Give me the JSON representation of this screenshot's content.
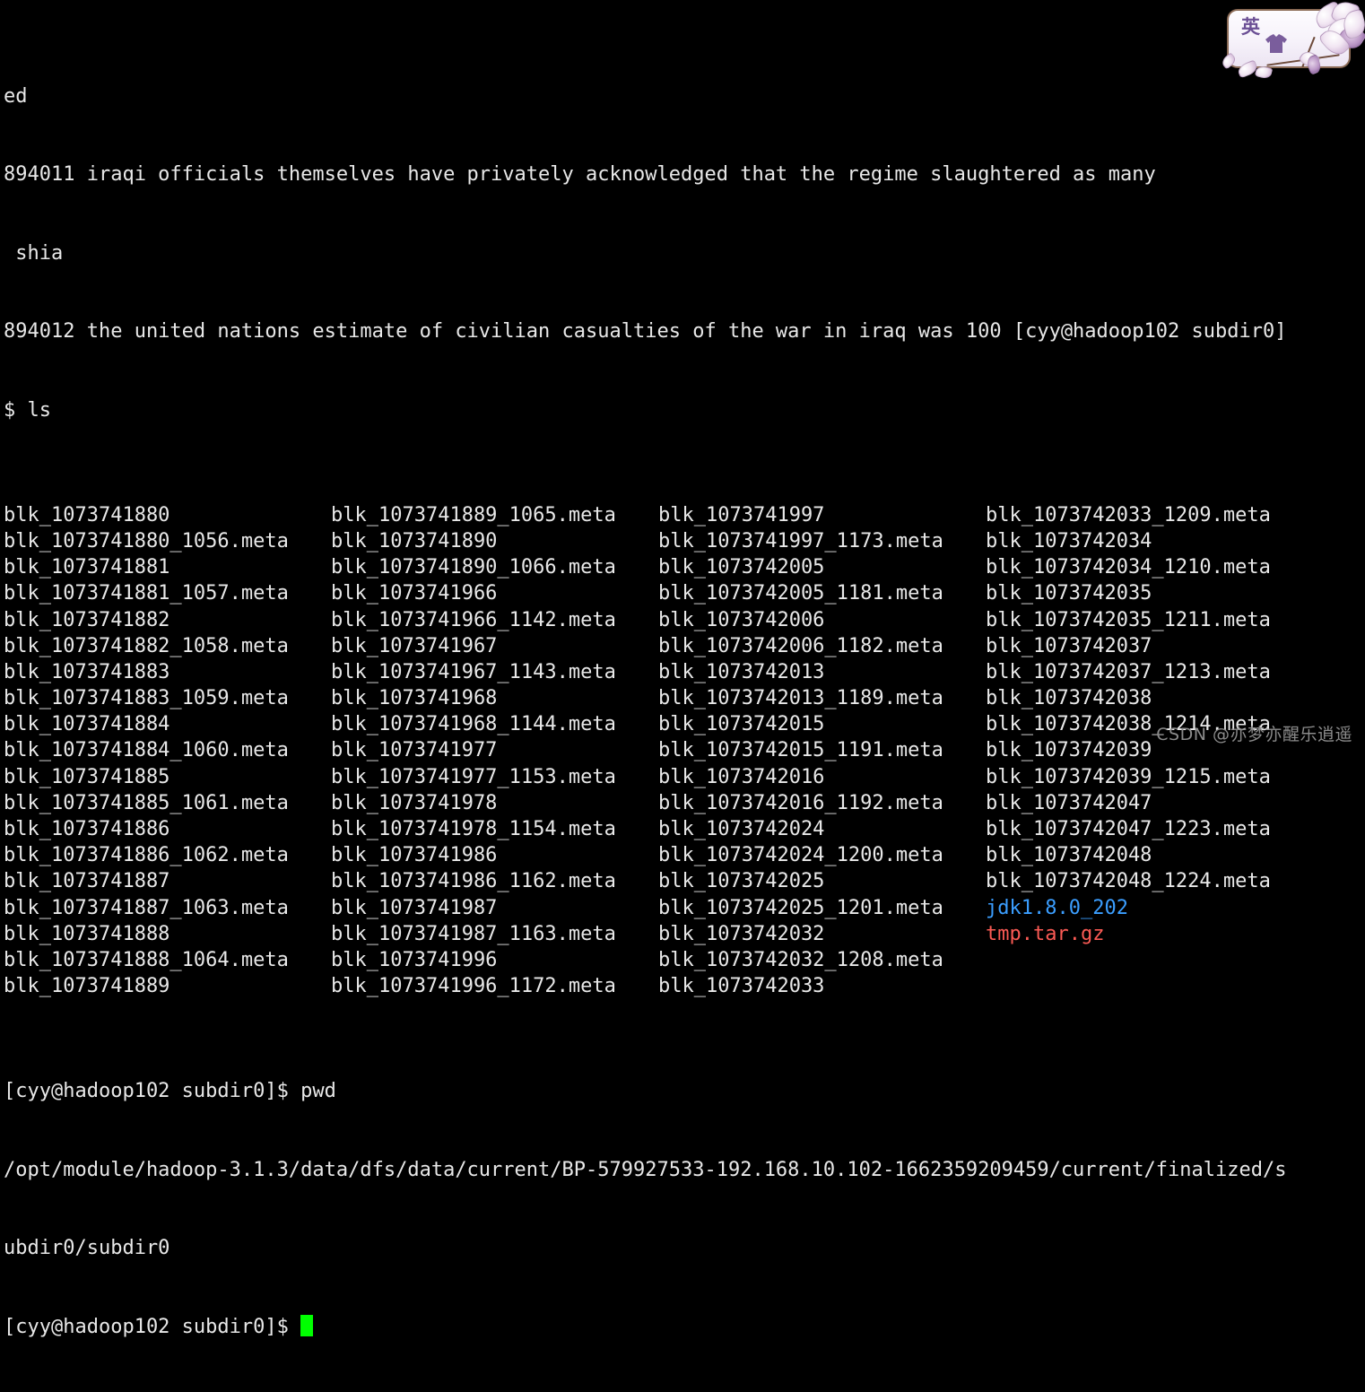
{
  "terminal": {
    "scrollback": [
      "ed",
      "894011 iraqi officials themselves have privately acknowledged that the regime slaughtered as many",
      " shia",
      "894012 the united nations estimate of civilian casualties of the war in iraq was 100 [cyy@hadoop102 subdir0]",
      "$ ls"
    ],
    "ls_rows": [
      [
        "blk_1073741880",
        "blk_1073741889_1065.meta",
        "blk_1073741997",
        "blk_1073742033_1209.meta"
      ],
      [
        "blk_1073741880_1056.meta",
        "blk_1073741890",
        "blk_1073741997_1173.meta",
        "blk_1073742034"
      ],
      [
        "blk_1073741881",
        "blk_1073741890_1066.meta",
        "blk_1073742005",
        "blk_1073742034_1210.meta"
      ],
      [
        "blk_1073741881_1057.meta",
        "blk_1073741966",
        "blk_1073742005_1181.meta",
        "blk_1073742035"
      ],
      [
        "blk_1073741882",
        "blk_1073741966_1142.meta",
        "blk_1073742006",
        "blk_1073742035_1211.meta"
      ],
      [
        "blk_1073741882_1058.meta",
        "blk_1073741967",
        "blk_1073742006_1182.meta",
        "blk_1073742037"
      ],
      [
        "blk_1073741883",
        "blk_1073741967_1143.meta",
        "blk_1073742013",
        "blk_1073742037_1213.meta"
      ],
      [
        "blk_1073741883_1059.meta",
        "blk_1073741968",
        "blk_1073742013_1189.meta",
        "blk_1073742038"
      ],
      [
        "blk_1073741884",
        "blk_1073741968_1144.meta",
        "blk_1073742015",
        "blk_1073742038_1214.meta"
      ],
      [
        "blk_1073741884_1060.meta",
        "blk_1073741977",
        "blk_1073742015_1191.meta",
        "blk_1073742039"
      ],
      [
        "blk_1073741885",
        "blk_1073741977_1153.meta",
        "blk_1073742016",
        "blk_1073742039_1215.meta"
      ],
      [
        "blk_1073741885_1061.meta",
        "blk_1073741978",
        "blk_1073742016_1192.meta",
        "blk_1073742047"
      ],
      [
        "blk_1073741886",
        "blk_1073741978_1154.meta",
        "blk_1073742024",
        "blk_1073742047_1223.meta"
      ],
      [
        "blk_1073741886_1062.meta",
        "blk_1073741986",
        "blk_1073742024_1200.meta",
        "blk_1073742048"
      ],
      [
        "blk_1073741887",
        "blk_1073741986_1162.meta",
        "blk_1073742025",
        "blk_1073742048_1224.meta"
      ],
      [
        "blk_1073741887_1063.meta",
        "blk_1073741987",
        "blk_1073742025_1201.meta",
        "jdk1.8.0_202"
      ],
      [
        "blk_1073741888",
        "blk_1073741987_1163.meta",
        "blk_1073742032",
        "tmp.tar.gz"
      ],
      [
        "blk_1073741888_1064.meta",
        "blk_1073741996",
        "blk_1073742032_1208.meta",
        ""
      ],
      [
        "blk_1073741889",
        "blk_1073741996_1172.meta",
        "blk_1073742033",
        ""
      ]
    ],
    "ls_colors": {
      "jdk1.8.0_202": "#3b9eff",
      "tmp.tar.gz": "#fa5a54",
      "default": "#e8e8e8"
    },
    "prompt_pwd_line": "[cyy@hadoop102 subdir0]$ pwd",
    "pwd_output_line1": "/opt/module/hadoop-3.1.3/data/dfs/data/current/BP-579927533-192.168.10.102-1662359209459/current/finalized/s",
    "pwd_output_line2": "ubdir0/subdir0",
    "prompt_current": "[cyy@hadoop102 subdir0]$ ",
    "cursor_color": "#00ff00",
    "background_color": "#000000",
    "foreground_color": "#e8e8e8"
  },
  "ime_widget": {
    "mode_label": "英",
    "shirt_icon": "shirt-icon",
    "moon_icon": "crescent-moon-icon",
    "flower_decoration": "magnolia-flower-decoration"
  },
  "watermark": {
    "text": "CSDN @亦梦亦醒乐逍遥"
  }
}
